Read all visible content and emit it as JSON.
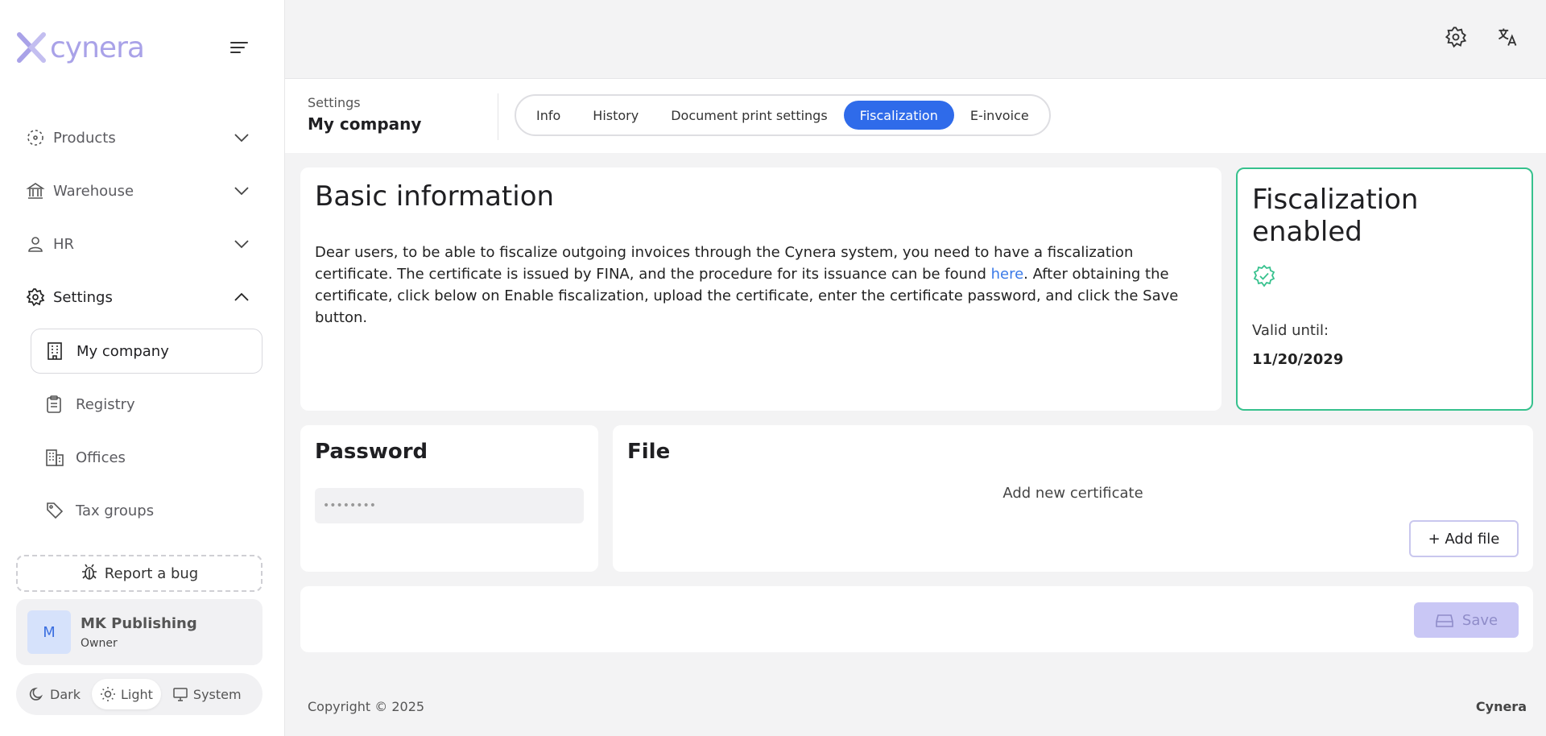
{
  "brand": {
    "logo_text": "cynera",
    "logo_color": "#a9a2e8"
  },
  "sidebar": {
    "nav": [
      {
        "label": "Products",
        "icon": "dashed-box-icon",
        "expanded": false
      },
      {
        "label": "Warehouse",
        "icon": "bank-icon",
        "expanded": false
      },
      {
        "label": "HR",
        "icon": "user-icon",
        "expanded": false
      },
      {
        "label": "Settings",
        "icon": "gear-icon",
        "expanded": true
      }
    ],
    "settings_items": [
      {
        "label": "My company",
        "icon": "building-icon",
        "active": true
      },
      {
        "label": "Registry",
        "icon": "clipboard-icon",
        "active": false
      },
      {
        "label": "Offices",
        "icon": "office-building-icon",
        "active": false
      },
      {
        "label": "Tax groups",
        "icon": "tag-icon",
        "active": false
      }
    ],
    "report_bug_label": "Report a bug",
    "user": {
      "initial": "M",
      "name": "MK Publishing",
      "role": "Owner"
    },
    "theme": {
      "options": [
        "Dark",
        "Light",
        "System"
      ],
      "selected": "Light"
    }
  },
  "header": {
    "breadcrumb_parent": "Settings",
    "breadcrumb_title": "My company",
    "tabs": [
      "Info",
      "History",
      "Document print settings",
      "Fiscalization",
      "E-invoice"
    ],
    "active_tab": "Fiscalization",
    "accent_color": "#2f6bea"
  },
  "basic_info": {
    "title": "Basic information",
    "text_before_link": "Dear users, to be able to fiscalize outgoing invoices through the Cynera system, you need to have a fiscalization certificate. The certificate is issued by FINA, and the procedure for its issuance can be found ",
    "link_text": "here",
    "text_after_link": ". After obtaining the certificate, click below on Enable fiscalization, upload the certificate, enter the certificate password, and click the Save button."
  },
  "fiscalization": {
    "title": "Fiscalization enabled",
    "valid_label": "Valid until:",
    "valid_date": "11/20/2029",
    "status_color": "#36c18d"
  },
  "password": {
    "title": "Password",
    "value": "••••••••"
  },
  "file": {
    "title": "File",
    "hint": "Add new certificate",
    "add_label": "+ Add file"
  },
  "save": {
    "label": "Save"
  },
  "footer": {
    "copyright": "Copyright © 2025",
    "brand": "Cynera"
  }
}
